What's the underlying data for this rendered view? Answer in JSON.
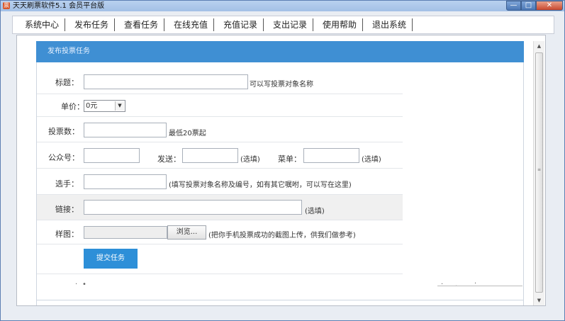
{
  "window": {
    "title": "天天刷票软件5.1 会员平台版",
    "icon": "app-icon",
    "minimize": "—",
    "maximize": "□",
    "close": "✕"
  },
  "menu": {
    "tabs": [
      "系统中心",
      "发布任务",
      "查看任务",
      "在线充值",
      "充值记录",
      "支出记录",
      "使用帮助",
      "退出系统"
    ],
    "active_index": 1
  },
  "panel": {
    "title": "发布投票任务"
  },
  "form": {
    "title_label": "标题：",
    "title_hint": "可以写投票对象名称",
    "price_label": "单价：",
    "price_value": "0元",
    "votes_label": "投票数：",
    "votes_hint": "最低20票起",
    "account_label": "公众号：",
    "send_label": "发送：",
    "send_hint": "(选填)",
    "menu_label": "菜单：",
    "menu_hint": "(选填)",
    "player_label": "选手：",
    "player_hint": "(填写投票对象名称及编号，如有其它嘱咐，可以写在这里)",
    "link_label": "链接：",
    "link_hint": "(选填)",
    "sample_label": "样图：",
    "browse_label": "浏览...",
    "sample_hint": "(把你手机投票成功的截图上传，供我们做参考)",
    "submit_label": "提交任务"
  },
  "colors": {
    "accent": "#3f8fd3",
    "submit": "#2d8fd8",
    "titlebar": "#b9d1ef"
  }
}
